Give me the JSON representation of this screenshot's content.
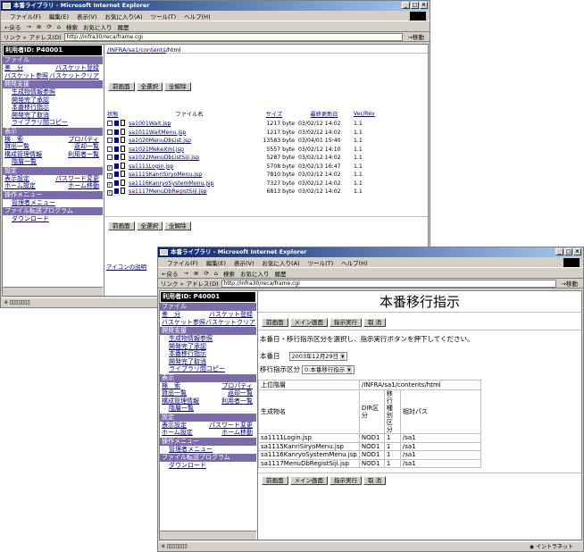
{
  "window1": {
    "title": "本番ライブラリ - Microsoft Internet Explorer",
    "menu": [
      "ファイル(F)",
      "編集(E)",
      "表示(V)",
      "お気に入り(A)",
      "ツール(T)",
      "ヘルプ(H)"
    ],
    "toolbar": [
      "←戻る",
      "→",
      "⊗",
      "⟳",
      "⌂",
      "検索",
      "お気に入り",
      "履歴"
    ],
    "links_label": "リンク »",
    "address_label": "アドレス(D)",
    "url": "http://infra30/reca/frame.cgi",
    "go_label": "移動",
    "breadcrumb": [
      "/INFRA",
      "/sa1",
      "/contents",
      "/html"
    ],
    "buttons": [
      "前画面",
      "全選択",
      "全解除"
    ],
    "col_status": "状態",
    "col_filename": "ファイル名",
    "col_size": "サイズ",
    "col_updated": "最終更新日",
    "col_ver": "Ver/Rev",
    "files": [
      {
        "checked": false,
        "name": "sa1001Wait.jsp",
        "size": "1217 byte",
        "date": "03/02/12 14:02",
        "ver": "1.1"
      },
      {
        "checked": false,
        "name": "sa1011WaitMenu.jsp",
        "size": "1217 byte",
        "date": "03/02/12 14:02",
        "ver": "1.1"
      },
      {
        "checked": false,
        "name": "sa1020MenuDbList.jsp",
        "size": "13583 byte",
        "date": "03/04/01 15:40",
        "ver": "1.1"
      },
      {
        "checked": false,
        "name": "sa1021MekeXml.jsp",
        "size": "5557 byte",
        "date": "03/02/12 14:10",
        "ver": "1.1"
      },
      {
        "checked": false,
        "name": "sa1022MenuDbListSiji.jsp",
        "size": "5287 byte",
        "date": "03/02/12 14:02",
        "ver": "1.1"
      },
      {
        "checked": true,
        "name": "sa1111Login.jsp",
        "size": "5708 byte",
        "date": "03/02/13 16:47",
        "ver": "1.1"
      },
      {
        "checked": true,
        "name": "sa1115KanriSiryoMenu.jsp",
        "size": "7810 byte",
        "date": "03/02/12 14:02",
        "ver": "1.1"
      },
      {
        "checked": true,
        "name": "sa1116KanryoSystemMenu.jsp",
        "size": "7327 byte",
        "date": "03/02/12 14:02",
        "ver": "1.1"
      },
      {
        "checked": true,
        "name": "sa1117MenuDbRegistSiji.jsp",
        "size": "6813 byte",
        "date": "03/02/12 14:02",
        "ver": "1.1"
      }
    ],
    "icon_help": "アイコンの説明"
  },
  "sidebar": {
    "user_label": "利用者ID: P40001",
    "file_section": "ファイル",
    "file_rows": [
      [
        "差　分",
        "バスケット登録"
      ],
      [
        "バスケット参照",
        "バスケットクリア"
      ]
    ],
    "dev_section": "開発支援",
    "dev_items": [
      "生成物情報参照",
      "開発完了承認",
      "本番移行指示",
      "開発完了取消",
      "ライブラリ間コピー"
    ],
    "view_section": "表示",
    "view_rows": [
      [
        "検　索",
        "プロパティ"
      ],
      [
        "貸出一覧",
        "返却一覧"
      ],
      [
        "構成管理情報",
        "利用者一覧"
      ]
    ],
    "view_last": "階層一覧",
    "settings_section": "設定",
    "settings_rows": [
      [
        "表示設定",
        "パスワード変更"
      ],
      [
        "ホーム設定",
        "ホーム移動"
      ]
    ],
    "op_section": "操作メニュー",
    "op_items": [
      "管理者メニュー"
    ],
    "transfer_section": "ファイル転送プログラム",
    "transfer_items": [
      "ダウンロード"
    ]
  },
  "window2": {
    "title": "本番ライブラリ - Microsoft Internet Explorer",
    "page_title": "本番移行指示",
    "buttons": [
      "前画面",
      "メイン画面",
      "指示実行",
      "取 消"
    ],
    "instruction": "本番日・移行指示区分を選択し、指示実行ボタンを押下してください。",
    "date_label": "本番日",
    "date_value": "2003年12月29日",
    "kind_label": "移行指示区分",
    "kind_value": "0:本番移行指示",
    "parent_label": "上位階層",
    "parent_value": "/INFRA/sa1/contents/html",
    "col_name": "生成物名",
    "col_dir": "DIR区分",
    "col_kind": "移行種別区分",
    "col_path": "相対パス",
    "rows": [
      {
        "name": "sa1111Login.jsp",
        "dir": "NOD1",
        "kind": "1",
        "path": "/sa1"
      },
      {
        "name": "sa1115KanriSiryoMenu.jsp",
        "dir": "NOD1",
        "kind": "1",
        "path": "/sa1"
      },
      {
        "name": "sa1116KanryoSystemMenu.jsp",
        "dir": "NOD1",
        "kind": "1",
        "path": "/sa1"
      },
      {
        "name": "sa1117MenuDbRegistSiji.jsp",
        "dir": "NOD1",
        "kind": "1",
        "path": "/sa1"
      }
    ],
    "status_zone": "イントラネット"
  }
}
